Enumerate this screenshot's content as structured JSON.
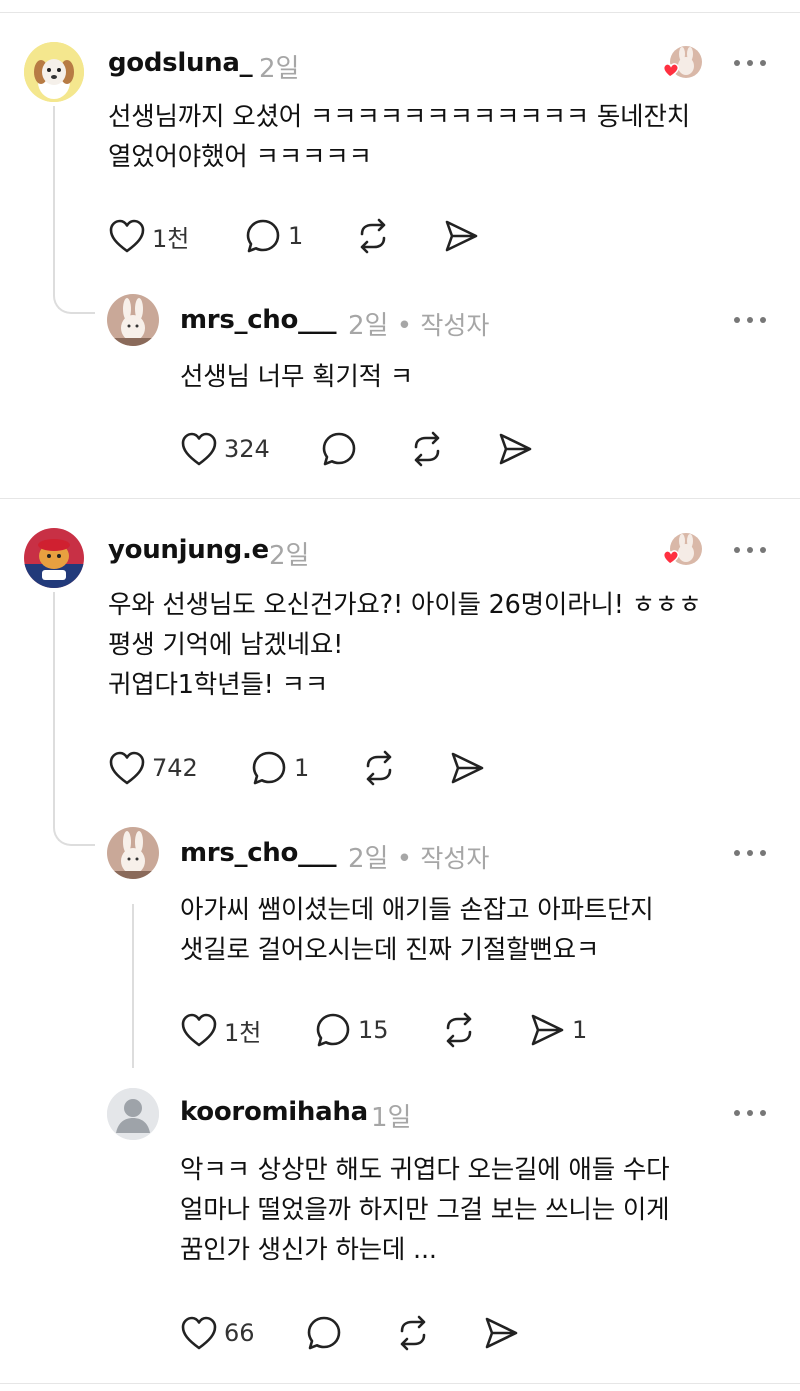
{
  "comments": [
    {
      "username": "godsluna_",
      "time": "2일",
      "text_lines": [
        "선생님까지 오셨어 ㅋㅋㅋㅋㅋㅋㅋㅋㅋㅋㅋㅋ 동네잔치",
        "열었어야했어 ㅋㅋㅋㅋㅋ"
      ],
      "likes": "1천",
      "replies": "1",
      "replies_list": [
        {
          "username": "mrs_cho___",
          "time": "2일",
          "author_label": "작성자",
          "text_lines": [
            "선생님 너무 획기적 ㅋ"
          ],
          "likes": "324"
        }
      ]
    },
    {
      "username": "younjung.e",
      "time": "2일",
      "text_lines": [
        "우와 선생님도 오신건가요?! 아이들 26명이라니! ㅎㅎㅎ",
        "평생 기억에 남겠네요!",
        "귀엽다1학년들! ㅋㅋ"
      ],
      "likes": "742",
      "replies": "1",
      "replies_list": [
        {
          "username": "mrs_cho___",
          "time": "2일",
          "author_label": "작성자",
          "text_lines": [
            "아가씨 쌤이셨는데 애기들 손잡고 아파트단지",
            "샛길로 걸어오시는데 진짜 기절할뻔요ㅋ"
          ],
          "likes": "1천",
          "replies": "15",
          "shares": "1"
        },
        {
          "username": "kooromihaha",
          "time": "1일",
          "text_lines": [
            "악ㅋㅋ 상상만 해도 귀엽다 오는길에 애들 수다",
            "얼마나 떨었을까 하지만 그걸 보는 쓰니는 이게",
            "꿈인가 생신가 하는데 ..."
          ],
          "likes": "66"
        }
      ]
    }
  ],
  "icons": {
    "like": "heart-outline-icon",
    "reply": "speech-bubble-icon",
    "repost": "repost-icon",
    "share": "send-icon",
    "more": "more-horizontal-icon"
  },
  "colors": {
    "text": "#111111",
    "muted": "#a6a6a6",
    "heart_badge": "#ff3040",
    "thread_line": "#dddddd"
  }
}
